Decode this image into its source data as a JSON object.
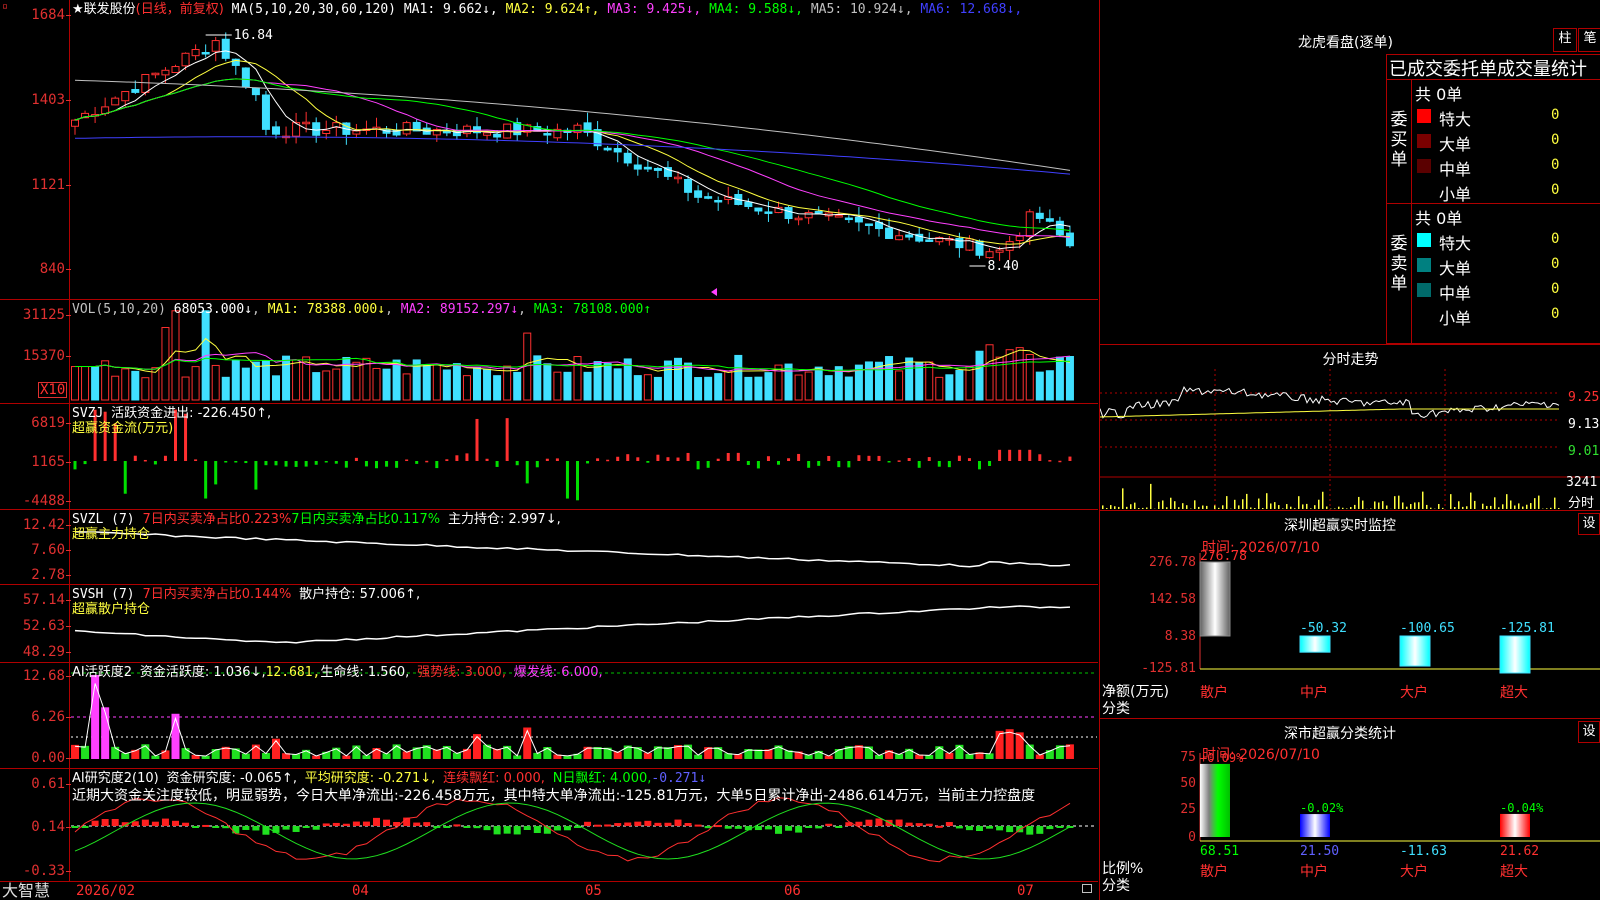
{
  "brand": "大智慧",
  "title": {
    "stock": "★联发股份",
    "mode": "(日线，前复权)"
  },
  "price_panel": {
    "ticks": [
      "1684",
      "1403",
      "1121",
      "840"
    ],
    "ma_label": "MA(5,10,20,30,60,120)",
    "ma": [
      {
        "name": "MA1",
        "value": "9.662",
        "arrow": "↓",
        "color": "#ffffff"
      },
      {
        "name": "MA2",
        "value": "9.624",
        "arrow": "↑",
        "color": "#ffff40"
      },
      {
        "name": "MA3",
        "value": "9.425",
        "arrow": "↓",
        "color": "#ff40ff"
      },
      {
        "name": "MA4",
        "value": "9.588",
        "arrow": "↓",
        "color": "#00ff00"
      },
      {
        "name": "MA5",
        "value": "10.924",
        "arrow": "↓",
        "color": "#c0c0c0"
      },
      {
        "name": "MA6",
        "value": "12.668",
        "arrow": "↓",
        "color": "#4040ff"
      }
    ],
    "high_label": "16.84",
    "low_label": "8.40"
  },
  "vol_panel": {
    "ticks": [
      "31125",
      "15370"
    ],
    "unit": "X10",
    "label": "VOL(5,10,20)",
    "value": "68053.000↓",
    "ma1": "MA1: 78388.000↓",
    "ma2": "MA2: 89152.297↓",
    "ma3": "MA3: 78108.000↑"
  },
  "svzj_panel": {
    "ticks": [
      "6819",
      "1165",
      "-4488"
    ],
    "label": "SVZJ",
    "text1": "活跃资金进出: -226.450↑,",
    "text2": "超赢资金流(万元)"
  },
  "svzl_panel": {
    "ticks": [
      "12.42",
      "7.60",
      "2.78"
    ],
    "label": "SVZL (7)",
    "a": "7日内买卖净占比0.223%",
    "b": "7日内买卖净占比0.117%",
    "c": "主力持仓: 2.997↓,",
    "sub": "超赢主力持仓"
  },
  "svsh_panel": {
    "ticks": [
      "57.14",
      "52.63",
      "48.29"
    ],
    "label": "SVSH (7)",
    "a": "7日内买卖净占比0.144%",
    "b": "散户持仓: 57.006↑,",
    "sub": "超赢散户持仓"
  },
  "ai1_panel": {
    "ticks": [
      "12.68",
      "6.26",
      "0.00"
    ],
    "label": "AI活跃度2",
    "a": "资金活跃度: 1.036↓,",
    "b": "12.681,",
    "c": "生命线: 1.560,",
    "d": "强势线: 3.000,",
    "e": "爆发线: 6.000,"
  },
  "ai2_panel": {
    "ticks": [
      "0.61",
      "0.14",
      "-0.33"
    ],
    "label": "AI研究度2(10)",
    "a": "资金研究度: -0.065↑,",
    "b": "平均研究度: -0.271↓,",
    "c": "连续飘红: 0.000,",
    "d": "N日飘红: 4.000,",
    "e": "-0.271↓",
    "note": "近期大资金关注度较低，明显弱势，今日大单净流出:-226.458万元，其中特大单净流出:-125.81万元，大单5日累计净出-2486.614万元，当前主力控盘度"
  },
  "dates": [
    "2026/02",
    "04",
    "05",
    "06",
    "07"
  ],
  "dragon": {
    "title": "龙虎看盘(逐单)",
    "btn1": "柱",
    "btn2": "笔",
    "subtitle": "已成交委托单成交量统计",
    "buy": {
      "side": "委买单",
      "total": "共 0单",
      "rows": [
        {
          "k": "特大",
          "n": "0",
          "p": "0%",
          "c": "#ff0000"
        },
        {
          "k": "大单",
          "n": "0",
          "p": "0%",
          "c": "#7a0000"
        },
        {
          "k": "中单",
          "n": "0",
          "p": "0%",
          "c": "#5a0000"
        },
        {
          "k": "小单",
          "n": "0",
          "p": "0%",
          "c": "#000000"
        }
      ]
    },
    "sell": {
      "side": "委卖单",
      "total": "共 0单",
      "rows": [
        {
          "k": "特大",
          "n": "0",
          "p": "0%",
          "c": "#00ffff"
        },
        {
          "k": "大单",
          "n": "0",
          "p": "0%",
          "c": "#008080"
        },
        {
          "k": "中单",
          "n": "0",
          "p": "0%",
          "c": "#006a6a"
        },
        {
          "k": "小单",
          "n": "0",
          "p": "0%",
          "c": "#000000"
        }
      ]
    }
  },
  "fenshi": {
    "title": "分时走势",
    "ticks": [
      "9.25",
      "9.13",
      "9.01"
    ],
    "vol": "3241",
    "vlabel": "分时"
  },
  "sz_monitor": {
    "title": "深圳超赢实时监控",
    "btn": "设",
    "time": "时间: 2026/07/10",
    "ylabel": "净额(万元)",
    "xlabel": "分类",
    "ticks": [
      "276.78",
      "142.58",
      "8.38",
      "-125.81"
    ],
    "bars": [
      {
        "name": "散户",
        "value": 276.78,
        "label": "276.78"
      },
      {
        "name": "中户",
        "value": -50.32,
        "label": "-50.32"
      },
      {
        "name": "大户",
        "value": -100.65,
        "label": "-100.65"
      },
      {
        "name": "超大",
        "value": -125.81,
        "label": "-125.81"
      }
    ]
  },
  "sz_class": {
    "title": "深市超赢分类统计",
    "btn": "设",
    "time": "时间: 2026/07/10",
    "ylabel": "比例%",
    "xlabel": "分类",
    "ticks": [
      "75",
      "50",
      "25",
      "0"
    ],
    "bars": [
      {
        "name": "散户",
        "value": 68.51,
        "top": "+0.09%",
        "bottom": "68.51"
      },
      {
        "name": "中户",
        "value": 21.5,
        "top": "-0.02%",
        "bottom": "21.50"
      },
      {
        "name": "大户",
        "value": 0,
        "top": "",
        "bottom": "-11.63"
      },
      {
        "name": "超大",
        "value": 21.62,
        "top": "-0.04%",
        "bottom": "21.62"
      }
    ]
  }
}
